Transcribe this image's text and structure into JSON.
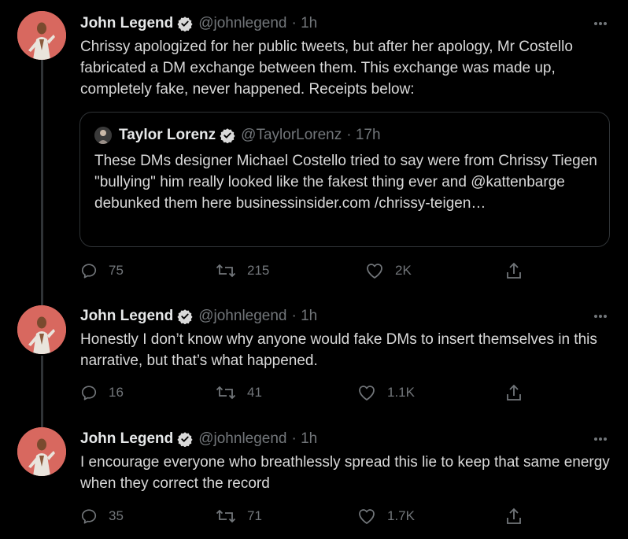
{
  "author": {
    "name": "John Legend",
    "handle": "@johnlegend"
  },
  "tweets": [
    {
      "time": "· 1h",
      "text": "Chrissy apologized for her public tweets, but after her apology, Mr Costello fabricated a DM exchange between them. This exchange was made up, completely fake, never happened. Receipts below:",
      "quote": {
        "name": "Taylor Lorenz",
        "handle": "@TaylorLorenz",
        "time": "· 17h",
        "text": "These DMs designer Michael Costello tried to say were from Chrissy Tiegen \"bullying\" him really looked like the fakest thing ever and @kattenbarge debunked them here businessinsider.com /chrissy-teigen…"
      },
      "replies": "75",
      "retweets": "215",
      "likes": "2K"
    },
    {
      "time": "· 1h",
      "text": "Honestly I don’t know why anyone would fake DMs to insert themselves in this narrative, but that’s what happened.",
      "replies": "16",
      "retweets": "41",
      "likes": "1.1K"
    },
    {
      "time": "· 1h",
      "text": "I encourage everyone who breathlessly spread this lie to keep that same energy when they correct the record",
      "replies": "35",
      "retweets": "71",
      "likes": "1.7K"
    }
  ],
  "icons": {
    "verified": "verified-badge-icon",
    "more": "more-dots-icon",
    "reply": "reply-icon",
    "retweet": "retweet-icon",
    "like": "heart-icon",
    "share": "share-icon"
  },
  "colors": {
    "background": "#000000",
    "text": "#d9d9d9",
    "secondary": "#72767a",
    "border": "#2f3336",
    "verified": "#d9d9d9",
    "avatar_bg": "#d8685f"
  }
}
